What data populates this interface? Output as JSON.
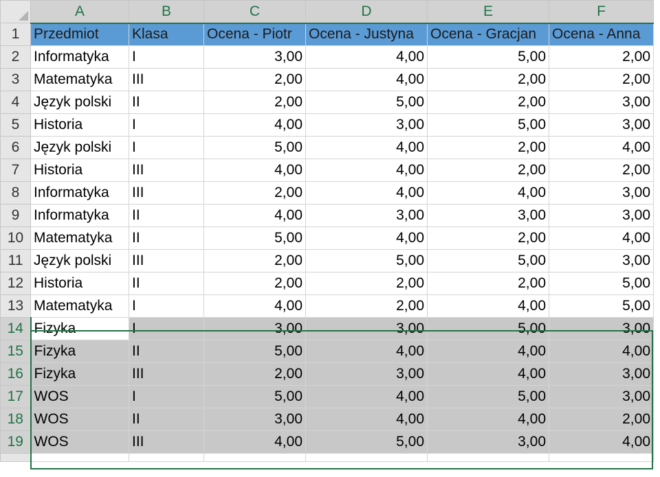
{
  "columns": [
    "A",
    "B",
    "C",
    "D",
    "E",
    "F"
  ],
  "header_row": {
    "num": "1",
    "cells": [
      "Przedmiot",
      "Klasa",
      "Ocena - Piotr",
      "Ocena - Justyna",
      "Ocena - Gracjan",
      "Ocena - Anna"
    ]
  },
  "rows": [
    {
      "num": "2",
      "cells": [
        "Informatyka",
        "I",
        "3,00",
        "4,00",
        "5,00",
        "2,00"
      ]
    },
    {
      "num": "3",
      "cells": [
        "Matematyka",
        "III",
        "2,00",
        "4,00",
        "2,00",
        "2,00"
      ]
    },
    {
      "num": "4",
      "cells": [
        "Język polski",
        "II",
        "2,00",
        "5,00",
        "2,00",
        "3,00"
      ]
    },
    {
      "num": "5",
      "cells": [
        "Historia",
        "I",
        "4,00",
        "3,00",
        "5,00",
        "3,00"
      ]
    },
    {
      "num": "6",
      "cells": [
        "Język polski",
        "I",
        "5,00",
        "4,00",
        "2,00",
        "4,00"
      ]
    },
    {
      "num": "7",
      "cells": [
        "Historia",
        "III",
        "4,00",
        "4,00",
        "2,00",
        "2,00"
      ]
    },
    {
      "num": "8",
      "cells": [
        "Informatyka",
        "III",
        "2,00",
        "4,00",
        "4,00",
        "3,00"
      ]
    },
    {
      "num": "9",
      "cells": [
        "Informatyka",
        "II",
        "4,00",
        "3,00",
        "3,00",
        "3,00"
      ]
    },
    {
      "num": "10",
      "cells": [
        "Matematyka",
        "II",
        "5,00",
        "4,00",
        "2,00",
        "4,00"
      ]
    },
    {
      "num": "11",
      "cells": [
        "Język polski",
        "III",
        "2,00",
        "5,00",
        "5,00",
        "3,00"
      ]
    },
    {
      "num": "12",
      "cells": [
        "Historia",
        "II",
        "2,00",
        "2,00",
        "2,00",
        "5,00"
      ]
    },
    {
      "num": "13",
      "cells": [
        "Matematyka",
        "I",
        "4,00",
        "2,00",
        "4,00",
        "5,00"
      ]
    },
    {
      "num": "14",
      "cells": [
        "Fizyka",
        "I",
        "3,00",
        "3,00",
        "5,00",
        "3,00"
      ]
    },
    {
      "num": "15",
      "cells": [
        "Fizyka",
        "II",
        "5,00",
        "4,00",
        "4,00",
        "4,00"
      ]
    },
    {
      "num": "16",
      "cells": [
        "Fizyka",
        "III",
        "2,00",
        "3,00",
        "4,00",
        "3,00"
      ]
    },
    {
      "num": "17",
      "cells": [
        "WOS",
        "I",
        "5,00",
        "4,00",
        "5,00",
        "3,00"
      ]
    },
    {
      "num": "18",
      "cells": [
        "WOS",
        "II",
        "3,00",
        "4,00",
        "4,00",
        "2,00"
      ]
    },
    {
      "num": "19",
      "cells": [
        "WOS",
        "III",
        "4,00",
        "5,00",
        "3,00",
        "4,00"
      ]
    }
  ],
  "selection": {
    "range": "A14:F19",
    "active_cell": "A14"
  },
  "colors": {
    "header_fill": "#5b9bd5",
    "selection_border": "#217346",
    "selection_fill": "#c8c8c8"
  }
}
